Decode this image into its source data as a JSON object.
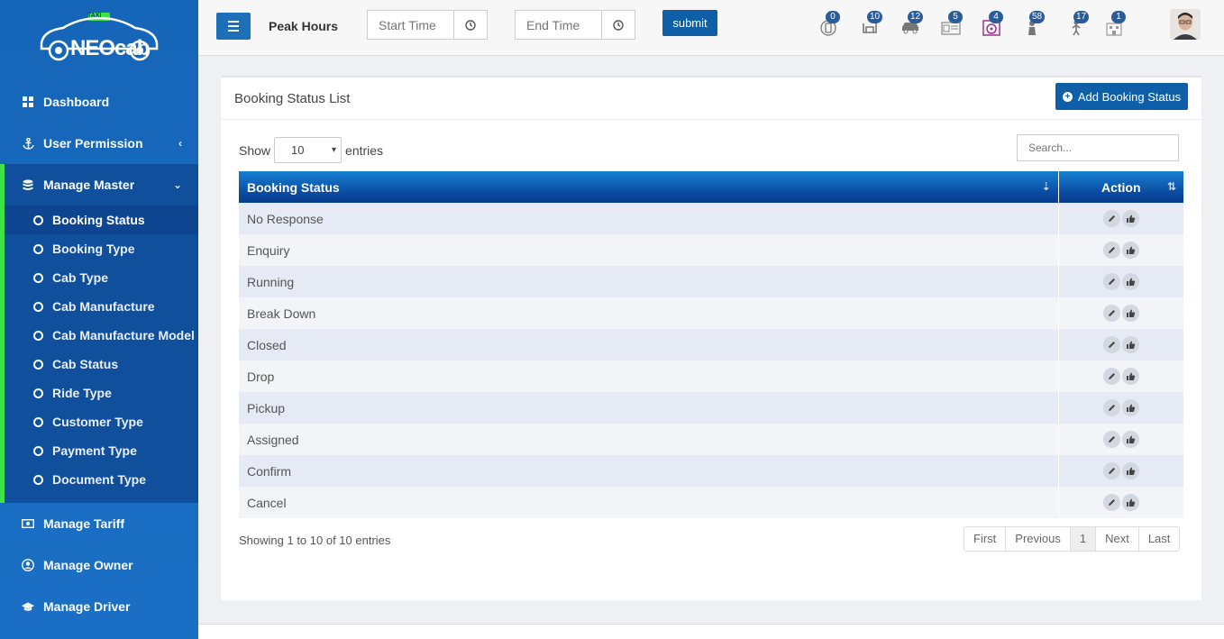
{
  "sidebar": {
    "logo_text": "NEOcab",
    "logo_sign": "TAXI",
    "items": [
      {
        "label": "Dashboard",
        "icon": "dashboard-icon"
      },
      {
        "label": "User Permission",
        "icon": "anchor-icon"
      }
    ],
    "master": {
      "label": "Manage Master",
      "icon": "database-icon",
      "children": [
        "Booking Status",
        "Booking Type",
        "Cab Type",
        "Cab Manufacture",
        "Cab Manufacture Model",
        "Cab Status",
        "Ride Type",
        "Customer Type",
        "Payment Type",
        "Document Type"
      ]
    },
    "lower": [
      {
        "label": "Manage Tariff",
        "icon": "money-icon"
      },
      {
        "label": "Manage Owner",
        "icon": "user-circle-icon"
      },
      {
        "label": "Manage Driver",
        "icon": "graduation-cap-icon"
      }
    ]
  },
  "topbar": {
    "title": "Peak Hours",
    "start_placeholder": "Start Time",
    "end_placeholder": "End Time",
    "submit_label": "submit",
    "badges": [
      "0",
      "10",
      "12",
      "5",
      "4",
      "58",
      "17",
      "1"
    ]
  },
  "panel": {
    "title": "Booking Status List",
    "add_label": "Add Booking Status",
    "show_label": "Show",
    "entries_label": "entries",
    "page_size": "10",
    "search_placeholder": "Search...",
    "columns": [
      "Booking Status",
      "Action"
    ],
    "rows": [
      "No Response",
      "Enquiry",
      "Running",
      "Break Down",
      "Closed",
      "Drop",
      "Pickup",
      "Assigned",
      "Confirm",
      "Cancel"
    ],
    "info": "Showing 1 to 10 of 10 entries",
    "pager": [
      "First",
      "Previous",
      "1",
      "Next",
      "Last"
    ]
  },
  "colors": {
    "sidebar": "#1565b8",
    "accent": "#0e5fa8",
    "active_bar": "#3ee34a"
  }
}
